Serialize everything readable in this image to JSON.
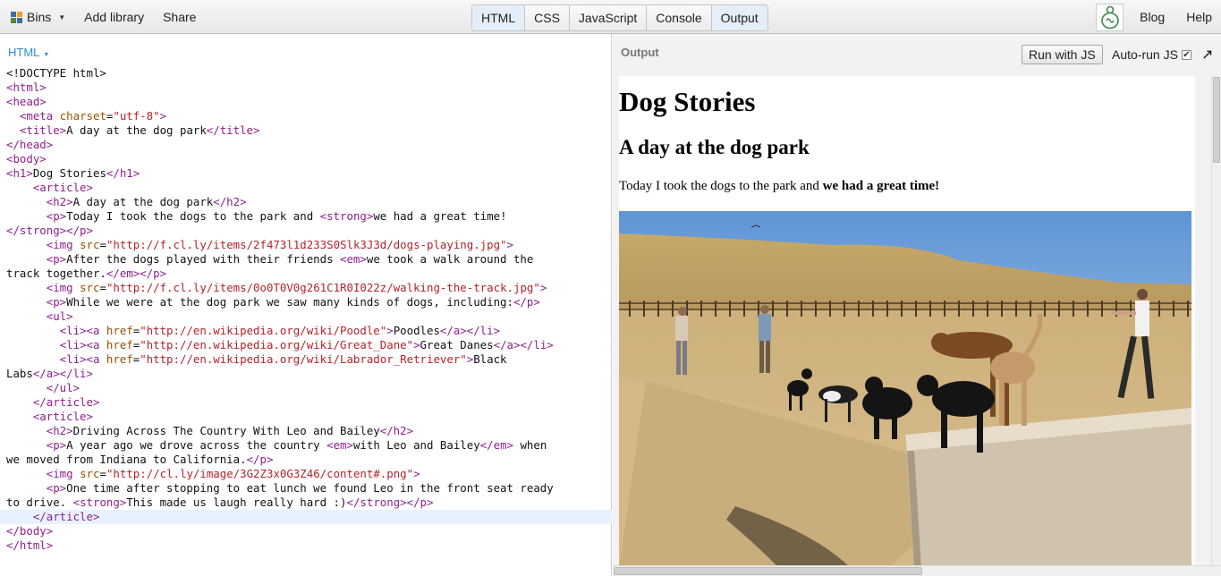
{
  "toolbar": {
    "bins_label": "Bins",
    "add_library": "Add library",
    "share": "Share",
    "tabs": [
      {
        "label": "HTML",
        "active": true
      },
      {
        "label": "CSS",
        "active": false
      },
      {
        "label": "JavaScript",
        "active": false
      },
      {
        "label": "Console",
        "active": false
      },
      {
        "label": "Output",
        "active": true
      }
    ],
    "blog": "Blog",
    "help": "Help"
  },
  "editor": {
    "mode_label": "HTML",
    "lines": [
      [
        [
          "t",
          "<!DOCTYPE html>"
        ]
      ],
      [
        [
          "g",
          "<html>"
        ]
      ],
      [
        [
          "g",
          "<head>"
        ]
      ],
      [
        [
          "t",
          "  "
        ],
        [
          "g",
          "<meta "
        ],
        [
          "a",
          "charset"
        ],
        [
          "t",
          "="
        ],
        [
          "s",
          "\"utf-8\""
        ],
        [
          "g",
          ">"
        ]
      ],
      [
        [
          "t",
          "  "
        ],
        [
          "g",
          "<title>"
        ],
        [
          "t",
          "A day at the dog park"
        ],
        [
          "g",
          "</title>"
        ]
      ],
      [
        [
          "g",
          "</head>"
        ]
      ],
      [
        [
          "g",
          "<body>"
        ]
      ],
      [
        [
          "g",
          "<h1>"
        ],
        [
          "t",
          "Dog Stories"
        ],
        [
          "g",
          "</h1>"
        ]
      ],
      [
        [
          "t",
          "    "
        ],
        [
          "g",
          "<article>"
        ]
      ],
      [
        [
          "t",
          "      "
        ],
        [
          "g",
          "<h2>"
        ],
        [
          "t",
          "A day at the dog park"
        ],
        [
          "g",
          "</h2>"
        ]
      ],
      [
        [
          "t",
          "      "
        ],
        [
          "g",
          "<p>"
        ],
        [
          "t",
          "Today I took the dogs to the park and "
        ],
        [
          "g",
          "<strong>"
        ],
        [
          "t",
          "we had a great time!"
        ]
      ],
      [
        [
          "g",
          "</strong></p>"
        ]
      ],
      [
        [
          "t",
          "      "
        ],
        [
          "g",
          "<img "
        ],
        [
          "a",
          "src"
        ],
        [
          "t",
          "="
        ],
        [
          "s",
          "\"http://f.cl.ly/items/2f473l1d233S0Slk3J3d/dogs-playing.jpg\""
        ],
        [
          "g",
          ">"
        ]
      ],
      [
        [
          "t",
          "      "
        ],
        [
          "g",
          "<p>"
        ],
        [
          "t",
          "After the dogs played with their friends "
        ],
        [
          "g",
          "<em>"
        ],
        [
          "t",
          "we took a walk around the"
        ]
      ],
      [
        [
          "t",
          "track together."
        ],
        [
          "g",
          "</em></p>"
        ]
      ],
      [
        [
          "t",
          "      "
        ],
        [
          "g",
          "<img "
        ],
        [
          "a",
          "src"
        ],
        [
          "t",
          "="
        ],
        [
          "s",
          "\"http://f.cl.ly/items/0o0T0V0g261C1R0I022z/walking-the-track.jpg\""
        ],
        [
          "g",
          ">"
        ]
      ],
      [
        [
          "t",
          "      "
        ],
        [
          "g",
          "<p>"
        ],
        [
          "t",
          "While we were at the dog park we saw many kinds of dogs, including:"
        ],
        [
          "g",
          "</p>"
        ]
      ],
      [
        [
          "t",
          "      "
        ],
        [
          "g",
          "<ul>"
        ]
      ],
      [
        [
          "t",
          "        "
        ],
        [
          "g",
          "<li><a "
        ],
        [
          "a",
          "href"
        ],
        [
          "t",
          "="
        ],
        [
          "s",
          "\"http://en.wikipedia.org/wiki/Poodle\""
        ],
        [
          "g",
          ">"
        ],
        [
          "t",
          "Poodles"
        ],
        [
          "g",
          "</a></li>"
        ]
      ],
      [
        [
          "t",
          "        "
        ],
        [
          "g",
          "<li><a "
        ],
        [
          "a",
          "href"
        ],
        [
          "t",
          "="
        ],
        [
          "s",
          "\"http://en.wikipedia.org/wiki/Great_Dane\""
        ],
        [
          "g",
          ">"
        ],
        [
          "t",
          "Great Danes"
        ],
        [
          "g",
          "</a></li>"
        ]
      ],
      [
        [
          "t",
          "        "
        ],
        [
          "g",
          "<li><a "
        ],
        [
          "a",
          "href"
        ],
        [
          "t",
          "="
        ],
        [
          "s",
          "\"http://en.wikipedia.org/wiki/Labrador_Retriever\""
        ],
        [
          "g",
          ">"
        ],
        [
          "t",
          "Black"
        ]
      ],
      [
        [
          "t",
          "Labs"
        ],
        [
          "g",
          "</a></li>"
        ]
      ],
      [
        [
          "t",
          "      "
        ],
        [
          "g",
          "</ul>"
        ]
      ],
      [
        [
          "t",
          "    "
        ],
        [
          "g",
          "</article>"
        ]
      ],
      [
        [
          "t",
          "    "
        ],
        [
          "g",
          "<article>"
        ]
      ],
      [
        [
          "t",
          "      "
        ],
        [
          "g",
          "<h2>"
        ],
        [
          "t",
          "Driving Across The Country With Leo and Bailey"
        ],
        [
          "g",
          "</h2>"
        ]
      ],
      [
        [
          "t",
          "      "
        ],
        [
          "g",
          "<p>"
        ],
        [
          "t",
          "A year ago we drove across the country "
        ],
        [
          "g",
          "<em>"
        ],
        [
          "t",
          "with Leo and Bailey"
        ],
        [
          "g",
          "</em>"
        ],
        [
          "t",
          " when"
        ]
      ],
      [
        [
          "t",
          "we moved from Indiana to California."
        ],
        [
          "g",
          "</p>"
        ]
      ],
      [
        [
          "t",
          "      "
        ],
        [
          "g",
          "<img "
        ],
        [
          "a",
          "src"
        ],
        [
          "t",
          "="
        ],
        [
          "s",
          "\"http://cl.ly/image/3G2Z3x0G3Z46/content#.png\""
        ],
        [
          "g",
          ">"
        ]
      ],
      [
        [
          "t",
          "      "
        ],
        [
          "g",
          "<p>"
        ],
        [
          "t",
          "One time after stopping to eat lunch we found Leo in the front seat ready"
        ]
      ],
      [
        [
          "t",
          "to drive. "
        ],
        [
          "g",
          "<strong>"
        ],
        [
          "t",
          "This made us laugh really hard :)"
        ],
        [
          "g",
          "</strong></p>"
        ]
      ],
      [
        [
          "t",
          "    "
        ],
        [
          "g",
          "</article>"
        ]
      ],
      [
        [
          "g",
          "</body>"
        ]
      ],
      [
        [
          "g",
          "</html>"
        ]
      ]
    ],
    "highlighted_line": 31
  },
  "output": {
    "label": "Output",
    "run_button": "Run with JS",
    "autorun_label": "Auto-run JS",
    "autorun_checked": "✔",
    "popout_icon": "↗",
    "rendered": {
      "h1": "Dog Stories",
      "h2": "A day at the dog park",
      "p_prefix": "Today I took the dogs to the park and ",
      "p_strong": "we had a great time!"
    }
  },
  "colors": {
    "tag": "#8e1e8e",
    "attr": "#9b4f00",
    "string": "#b5222b",
    "accent": "#2a8fd0"
  }
}
